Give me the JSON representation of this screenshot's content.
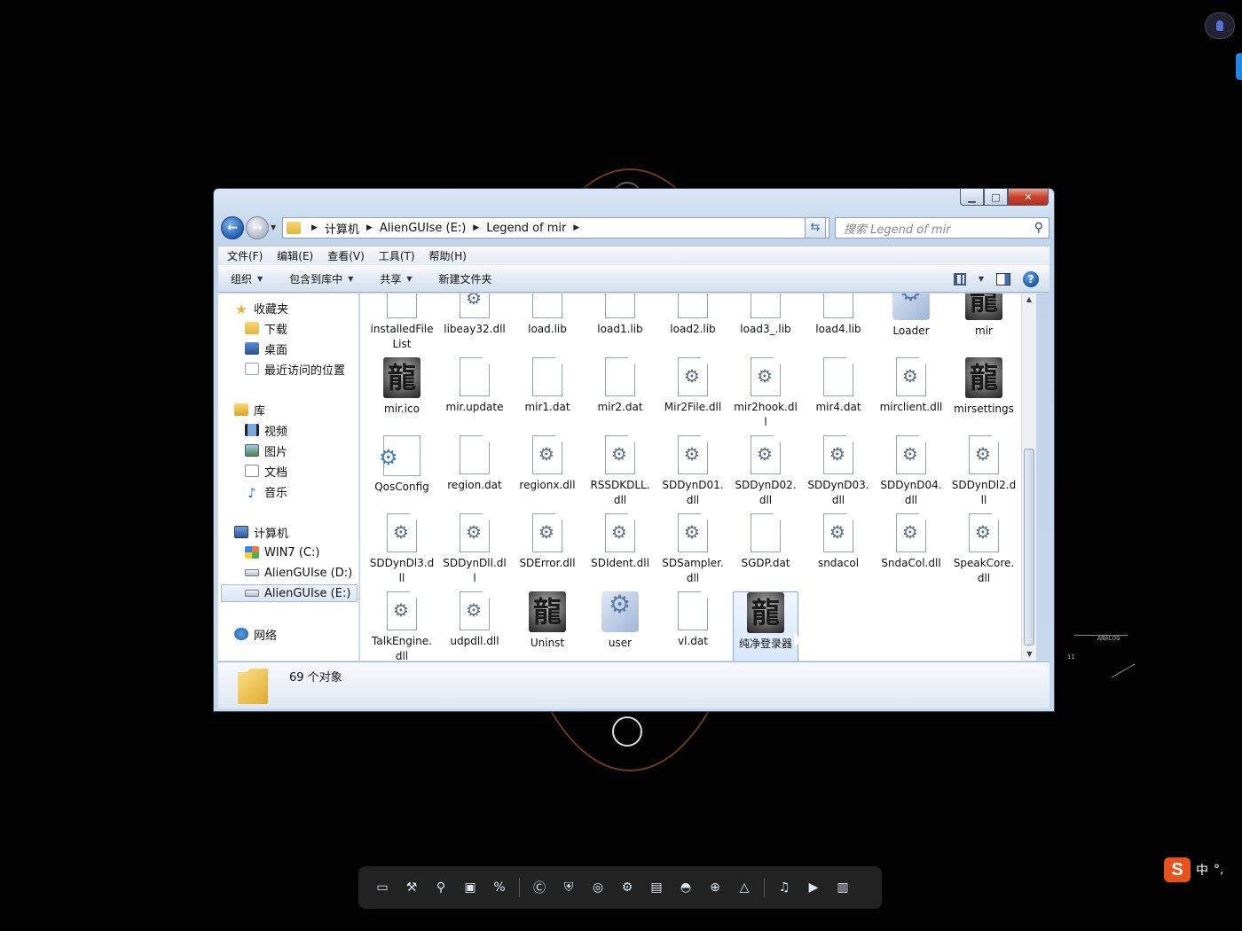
{
  "window": {
    "close_glyph": "✕",
    "min_glyph": "▁",
    "max_glyph": "□"
  },
  "address": {
    "crumbs": [
      "计算机",
      "AlienGUIse (E:)",
      "Legend of mir"
    ],
    "search_placeholder": "搜索 Legend of mir"
  },
  "menu": [
    "文件(F)",
    "编辑(E)",
    "查看(V)",
    "工具(T)",
    "帮助(H)"
  ],
  "commands": [
    "组织",
    "包含到库中",
    "共享",
    "新建文件夹"
  ],
  "nav": {
    "favorites": "收藏夹",
    "downloads": "下载",
    "desktop": "桌面",
    "recent": "最近访问的位置",
    "libraries": "库",
    "videos": "视频",
    "pictures": "图片",
    "documents": "文档",
    "music": "音乐",
    "computer": "计算机",
    "drive_c": "WIN7 (C:)",
    "drive_d": "AlienGUIse (D:)",
    "drive_e": "AlienGUIse (E:)",
    "network": "网络"
  },
  "files": [
    {
      "name": "installedFileList",
      "type": "file"
    },
    {
      "name": "libeay32.dll",
      "type": "dll"
    },
    {
      "name": "load.lib",
      "type": "file"
    },
    {
      "name": "load1.lib",
      "type": "file"
    },
    {
      "name": "load2.lib",
      "type": "file"
    },
    {
      "name": "load3_.lib",
      "type": "file"
    },
    {
      "name": "load4.lib",
      "type": "file"
    },
    {
      "name": "Loader",
      "type": "exe"
    },
    {
      "name": "mir",
      "type": "dragon"
    },
    {
      "name": "mir.ico",
      "type": "dragon"
    },
    {
      "name": "mir.update",
      "type": "file"
    },
    {
      "name": "mir1.dat",
      "type": "file"
    },
    {
      "name": "mir2.dat",
      "type": "file"
    },
    {
      "name": "Mir2File.dll",
      "type": "dll"
    },
    {
      "name": "mir2hook.dll",
      "type": "dll"
    },
    {
      "name": "mir4.dat",
      "type": "file"
    },
    {
      "name": "mirclient.dll",
      "type": "dll"
    },
    {
      "name": "mirsettings",
      "type": "dragon"
    },
    {
      "name": "QosConfig",
      "type": "cfg"
    },
    {
      "name": "region.dat",
      "type": "file"
    },
    {
      "name": "regionx.dll",
      "type": "dll"
    },
    {
      "name": "RSSDKDLL.dll",
      "type": "dll"
    },
    {
      "name": "SDDynD01.dll",
      "type": "dll"
    },
    {
      "name": "SDDynD02.dll",
      "type": "dll"
    },
    {
      "name": "SDDynD03.dll",
      "type": "dll"
    },
    {
      "name": "SDDynD04.dll",
      "type": "dll"
    },
    {
      "name": "SDDynDl2.dll",
      "type": "dll"
    },
    {
      "name": "SDDynDl3.dll",
      "type": "dll"
    },
    {
      "name": "SDDynDll.dll",
      "type": "dll"
    },
    {
      "name": "SDError.dll",
      "type": "dll"
    },
    {
      "name": "SDIdent.dll",
      "type": "dll"
    },
    {
      "name": "SDSampler.dll",
      "type": "dll"
    },
    {
      "name": "SGDP.dat",
      "type": "file"
    },
    {
      "name": "sndacol",
      "type": "dll"
    },
    {
      "name": "SndaCol.dll",
      "type": "dll"
    },
    {
      "name": "SpeakCore.dll",
      "type": "dll"
    },
    {
      "name": "TalkEngine.dll",
      "type": "dll"
    },
    {
      "name": "udpdll.dll",
      "type": "dll"
    },
    {
      "name": "Uninst",
      "type": "dragon"
    },
    {
      "name": "user",
      "type": "exe"
    },
    {
      "name": "vl.dat",
      "type": "file"
    },
    {
      "name": "纯净登录器",
      "type": "dragon",
      "selected": true
    }
  ],
  "dragon_glyph": "龍",
  "status": {
    "count": "69 个对象"
  },
  "ime": {
    "mode": "中",
    "punct": "°,",
    "logo": "S"
  },
  "dock_icons": [
    "monitor-icon",
    "tools-icon",
    "search-icon",
    "screen-icon",
    "percent-icon",
    "c-icon",
    "shield-icon",
    "steam-icon",
    "gear-icon",
    "doc-icon",
    "disk-icon",
    "globe-icon",
    "triangle-icon",
    "music-icon",
    "media-icon",
    "book-icon"
  ]
}
